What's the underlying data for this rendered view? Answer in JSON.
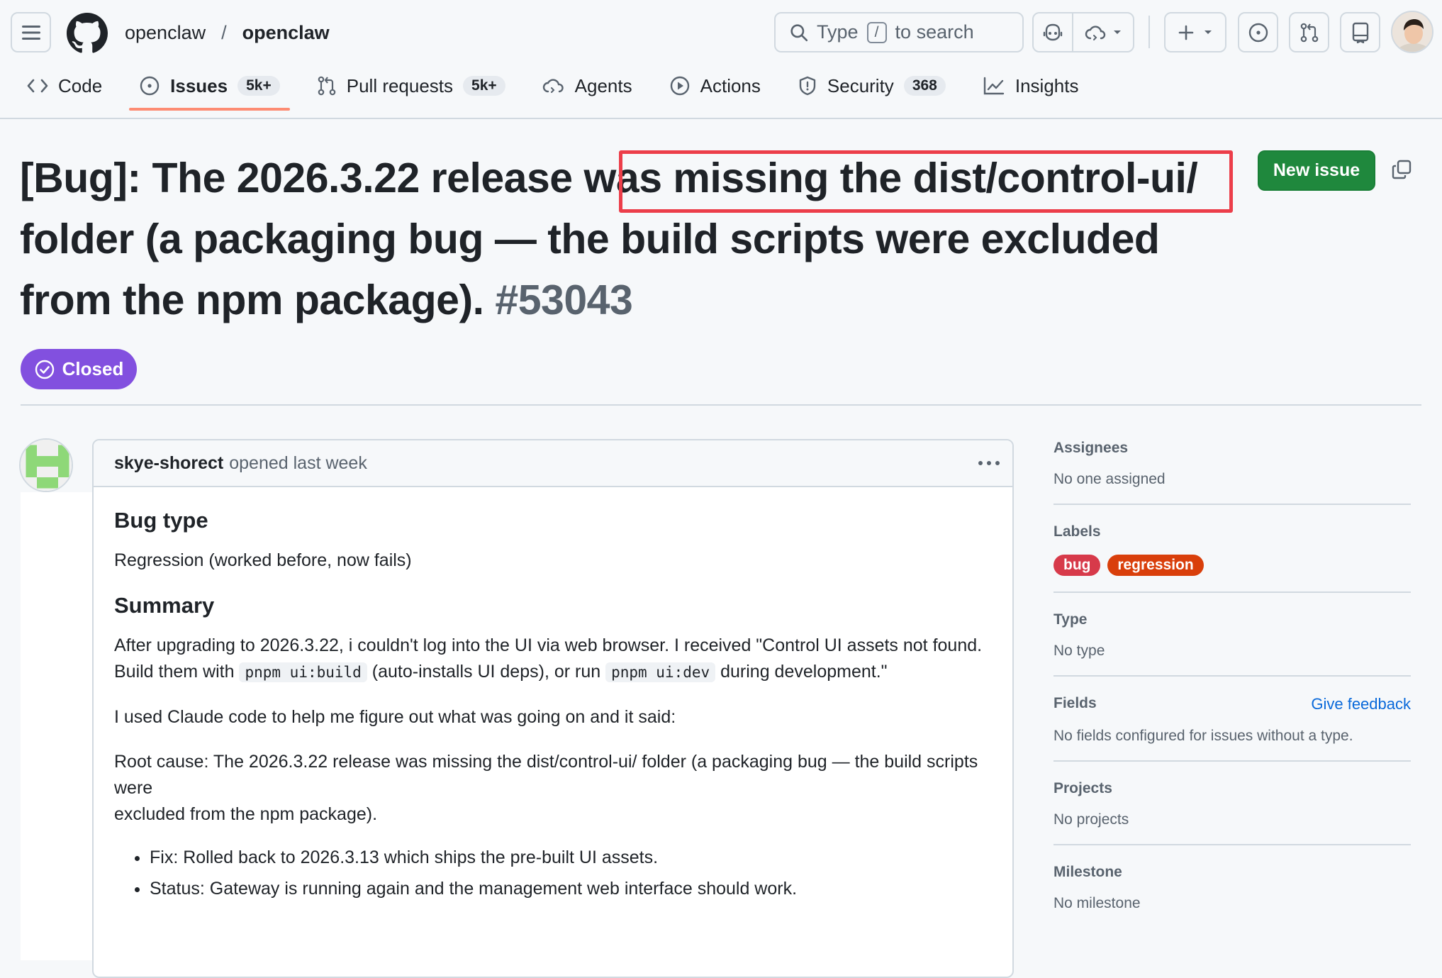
{
  "repo": {
    "owner": "openclaw",
    "separator": "/",
    "name": "openclaw"
  },
  "search": {
    "pre": "Type",
    "key": "/",
    "post": "to search"
  },
  "tabs": [
    {
      "label": "Code",
      "icon": "code-icon"
    },
    {
      "label": "Issues",
      "count": "5k+",
      "icon": "issue-opened-icon",
      "selected": true
    },
    {
      "label": "Pull requests",
      "count": "5k+",
      "icon": "pull-request-icon"
    },
    {
      "label": "Agents",
      "icon": "agent-icon"
    },
    {
      "label": "Actions",
      "icon": "play-icon"
    },
    {
      "label": "Security",
      "count": "368",
      "icon": "shield-icon"
    },
    {
      "label": "Insights",
      "icon": "graph-icon"
    }
  ],
  "issue": {
    "title_pre": "[Bug]: The 2026.3.22 release was ",
    "title_hl": "missing the dist/control-ui/ folder",
    "title_post": " (a packaging bug — the build scripts were excluded from the npm package).",
    "number": "#53043",
    "state": "Closed",
    "new_issue_label": "New issue"
  },
  "comment": {
    "author": "skye-shorect",
    "meta": "opened last week",
    "h_bug_type": "Bug type",
    "bug_type": "Regression (worked before, now fails)",
    "h_summary": "Summary",
    "p1_a": "After upgrading to 2026.3.22, i couldn't log into the UI via web browser. I received \"Control UI assets not found. Build them with ",
    "code1": "pnpm ui:build",
    "p1_b": " (auto-installs UI deps), or run ",
    "code2": "pnpm ui:dev",
    "p1_c": " during development.\"",
    "p2": "I used Claude code to help me figure out what was going on and it said:",
    "p3_a": "Root cause: The 2026.3.22 release was missing the dist/control-ui/ folder (a packaging bug — the build scripts were",
    "p3_b": "excluded from the npm package).",
    "bullets": [
      "Fix: Rolled back to 2026.3.13 which ships the pre-built UI assets.",
      "Status: Gateway is running again and the management web interface should work."
    ]
  },
  "sidebar": {
    "assignees": {
      "heading": "Assignees",
      "value": "No one assigned"
    },
    "labels": {
      "heading": "Labels",
      "items": [
        {
          "name": "bug",
          "color": "#d73a4a"
        },
        {
          "name": "regression",
          "color": "#d93f0b"
        }
      ]
    },
    "type": {
      "heading": "Type",
      "value": "No type"
    },
    "fields": {
      "heading": "Fields",
      "link": "Give feedback",
      "value": "No fields configured for issues without a type."
    },
    "projects": {
      "heading": "Projects",
      "value": "No projects"
    },
    "milestone": {
      "heading": "Milestone",
      "value": "No milestone"
    }
  }
}
